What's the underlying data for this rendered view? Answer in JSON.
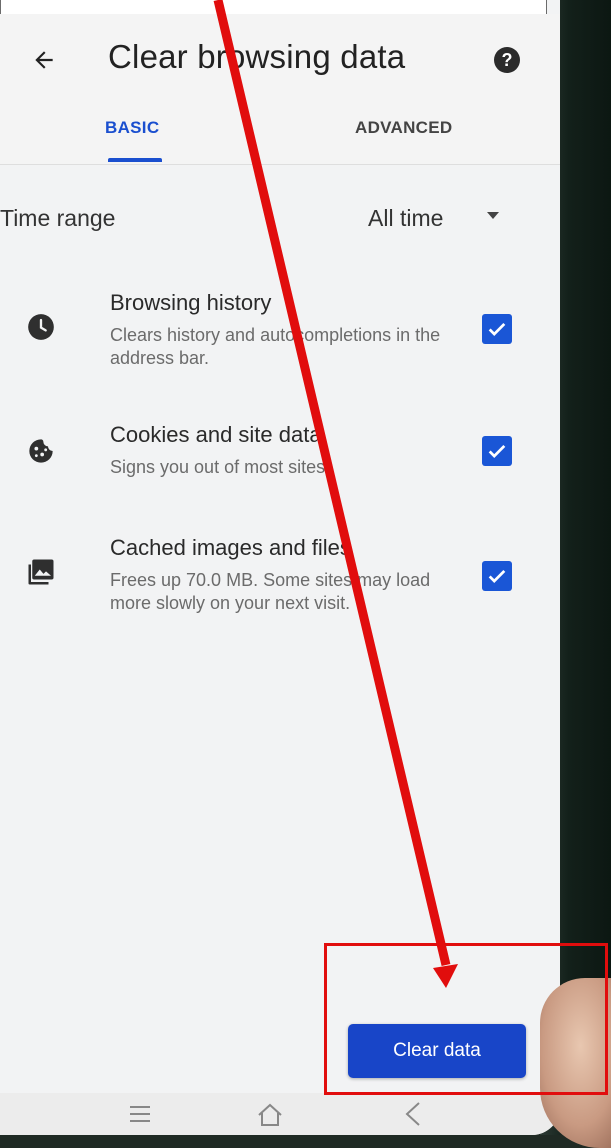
{
  "header": {
    "title": "Clear browsing data",
    "back_icon": "arrow-back-icon",
    "help_icon": "help-icon",
    "help_glyph": "?"
  },
  "tabs": [
    {
      "label": "BASIC",
      "selected": true
    },
    {
      "label": "ADVANCED",
      "selected": false
    }
  ],
  "time_range": {
    "label": "Time range",
    "value": "All time"
  },
  "items": [
    {
      "title": "Browsing history",
      "subtitle": "Clears history and autocompletions in the address bar.",
      "icon": "clock-icon",
      "checked": true
    },
    {
      "title": "Cookies and site data",
      "subtitle": "Signs you out of most sites.",
      "icon": "cookie-icon",
      "checked": true
    },
    {
      "title": "Cached images and files",
      "subtitle": "Frees up 70.0 MB. Some sites may load more slowly on your next visit.",
      "icon": "image-icon",
      "checked": true
    }
  ],
  "actions": {
    "clear_label": "Clear data"
  },
  "nav": {
    "recents_icon": "recents-icon",
    "home_icon": "home-icon",
    "back_icon": "nav-back-icon"
  },
  "colors": {
    "accent": "#1a4fcf",
    "button": "#1845c8",
    "annotation": "#e10d0d"
  }
}
